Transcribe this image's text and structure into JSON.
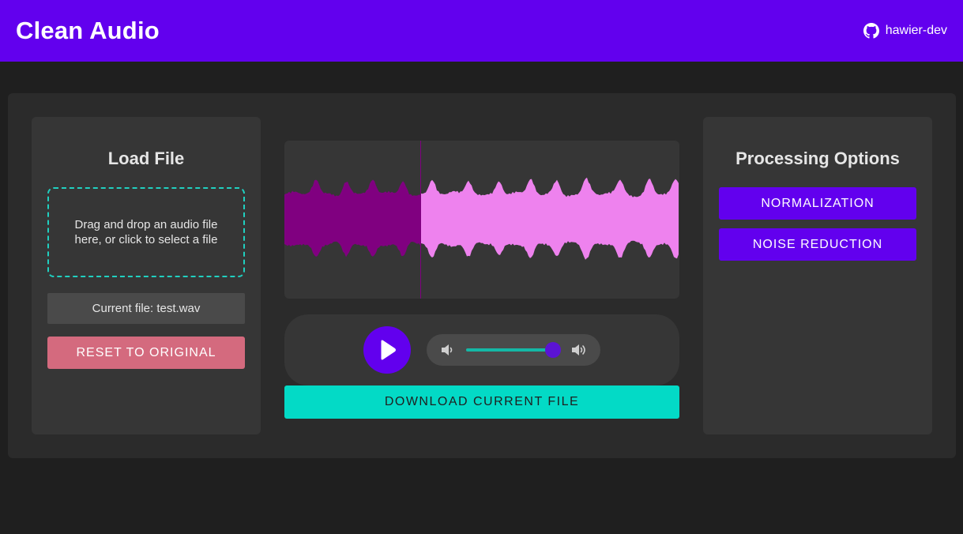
{
  "header": {
    "title": "Clean Audio",
    "github_user": "hawier-dev",
    "github_icon": "github-icon",
    "bar_color": "#6200ee"
  },
  "load_panel": {
    "title": "Load File",
    "dropzone_text": "Drag and drop an audio file here, or click to select a file",
    "current_file": "Current file: test.wav",
    "reset_label": "RESET TO ORIGINAL",
    "reset_color": "#d46a7e"
  },
  "waveform": {
    "played_color": "#800080",
    "unplayed_color": "#ee82ee",
    "progress": 0.345
  },
  "player": {
    "play_icon": "play-icon",
    "volume_low_icon": "volume-low-icon",
    "volume_high_icon": "volume-high-icon",
    "volume_level": 1.0
  },
  "download_label": "DOWNLOAD CURRENT FILE",
  "processing_panel": {
    "title": "Processing Options",
    "options": [
      "NORMALIZATION",
      "NOISE REDUCTION"
    ]
  },
  "colors": {
    "accent": "#6200ee",
    "teal": "#03dac6",
    "background": "#1f1f1f",
    "panel": "#2b2b2b",
    "card": "#363636"
  }
}
